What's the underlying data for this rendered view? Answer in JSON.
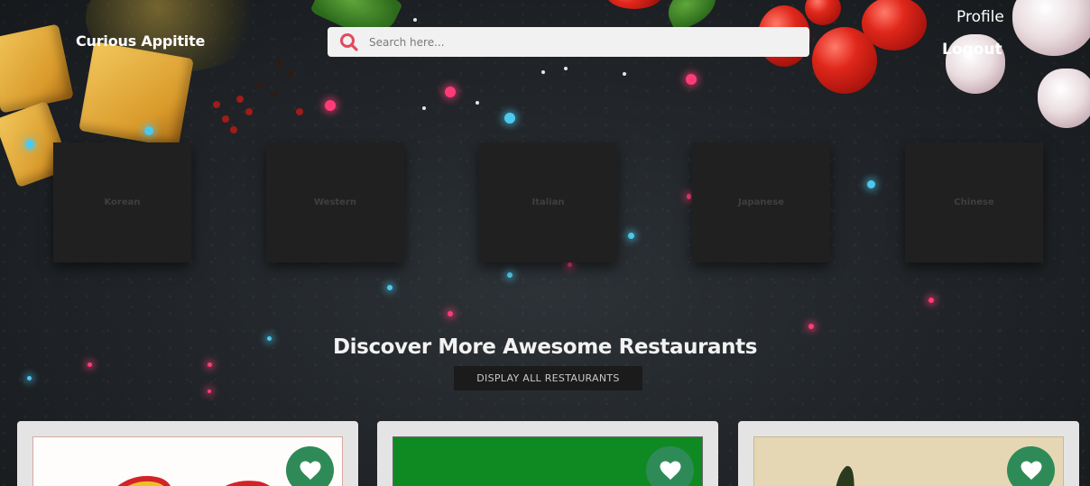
{
  "header": {
    "brand": "Curious Appitite",
    "search_placeholder": "Search here...",
    "profile_label": "Profile",
    "logout_label": "Logout"
  },
  "cuisines": [
    {
      "label": "Korean"
    },
    {
      "label": "Western"
    },
    {
      "label": "Italian"
    },
    {
      "label": "Japanese"
    },
    {
      "label": "Chinese"
    }
  ],
  "discover": {
    "title": "Discover More Awesome Restaurants",
    "button_label": "DISPLAY ALL RESTAURANTS"
  },
  "icons": {
    "search": "search-icon",
    "favorite": "heart-icon"
  },
  "colors": {
    "favorite_button": "#2e8b57",
    "search_icon": "#e24a5e",
    "tile_background": "#202020"
  }
}
